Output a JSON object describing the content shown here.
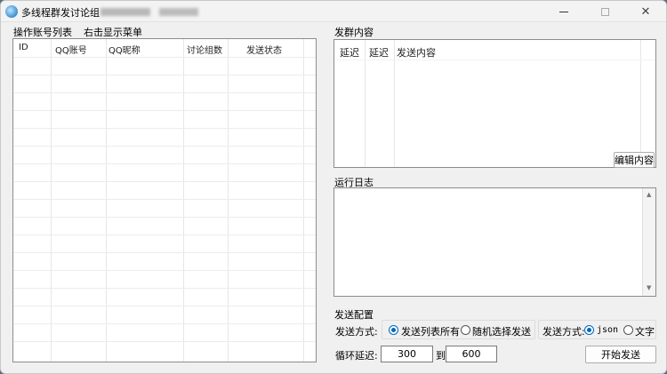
{
  "window": {
    "title": "多线程群发讨论组",
    "min_glyph": "—",
    "max_glyph": "☐",
    "close_glyph": "✕",
    "icon": "app-bubble-icon"
  },
  "accounts": {
    "label": "操作账号列表",
    "hint": "右击显示菜单",
    "columns": [
      "ID",
      "QQ账号",
      "QQ昵称",
      "讨论组数",
      "发送状态"
    ]
  },
  "content": {
    "label": "发群内容",
    "columns": [
      "延迟",
      "延迟",
      "发送内容"
    ],
    "edit_button": "编辑内容"
  },
  "log": {
    "label": "运行日志",
    "up_glyph": "▲",
    "down_glyph": "▼"
  },
  "config": {
    "label": "发送配置",
    "send_mode_label": "发送方式:",
    "option_all": "发送列表所有",
    "option_random": "随机选择发送",
    "send_format_label": "发送方式:",
    "option_json": "json",
    "option_text": "文字",
    "loop_delay_label": "循环延迟:",
    "delay_min": "300",
    "to_label": "到",
    "delay_max": "600",
    "start_button": "开始发送"
  },
  "colors": {
    "accent": "#0067c0",
    "window_bg": "#f0f0f0"
  }
}
